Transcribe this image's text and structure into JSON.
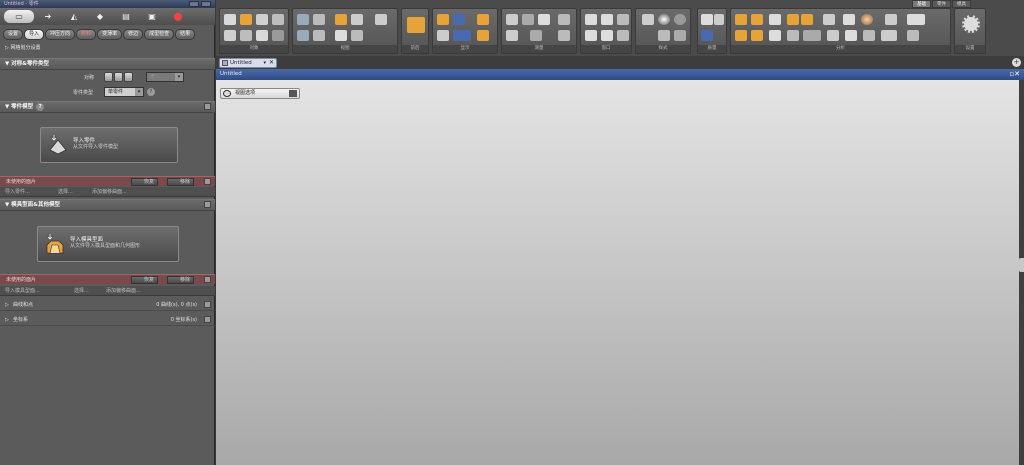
{
  "window": {
    "title": "Untitled - 零件"
  },
  "left_tabs": [
    {
      "label": "设置"
    },
    {
      "label": "导入"
    },
    {
      "label": "冲压方向"
    },
    {
      "label": "材料"
    },
    {
      "label": "变薄率"
    },
    {
      "label": "修边"
    },
    {
      "label": "成型检查"
    },
    {
      "label": "结果"
    }
  ],
  "mesh_settings": {
    "label": "网格划分设置"
  },
  "part_type_section": {
    "title": "对称&零件类型",
    "symmetry_label": "对称",
    "symmetry_value": "无",
    "part_type_label": "零件类型",
    "part_type_value": "单零件"
  },
  "part_model_section": {
    "title": "零件模型",
    "import_title": "导入零件",
    "import_sub": "从文件导入零件模型",
    "unused_label": "未使用的面片",
    "restore_label": "恢复",
    "delete_label": "移除",
    "import_dropdown": "导入零件...",
    "select_dropdown": "选择...",
    "offset_dropdown": "添加偏移曲面..."
  },
  "die_face_section": {
    "title": "模具型面&其他模型",
    "import_title": "导入模具型面",
    "import_sub": "从文件导入模具型面和几何图形",
    "unused_label": "未使用的面片",
    "restore_label": "恢复",
    "delete_label": "移除",
    "import_dropdown": "导入模具型面...",
    "select_dropdown": "选择...",
    "offset_dropdown": "添加偏移曲面..."
  },
  "curves_row": {
    "label": "曲线和点",
    "value": "0 曲线(s), 0 点(s)"
  },
  "coords_row": {
    "label": "坐标系",
    "value": "0 坐标系(s)"
  },
  "ribbon_tabs": [
    {
      "label": "基础"
    },
    {
      "label": "零件"
    },
    {
      "label": "模具"
    }
  ],
  "ribbon_groups": [
    {
      "label": "对象"
    },
    {
      "label": "视图"
    },
    {
      "label": "前后"
    },
    {
      "label": "显示"
    },
    {
      "label": "测量"
    },
    {
      "label": "窗口"
    },
    {
      "label": "样式"
    },
    {
      "label": "质量"
    },
    {
      "label": "分析"
    },
    {
      "label": "设置"
    }
  ],
  "document": {
    "tab_label": "Untitled",
    "viewport_title": "Untitled",
    "nav_label": "视图选项"
  },
  "colors": {
    "accent": "#2f4a86",
    "selection_bar": "#7a4a4a",
    "highlight": "#e8a23a"
  }
}
